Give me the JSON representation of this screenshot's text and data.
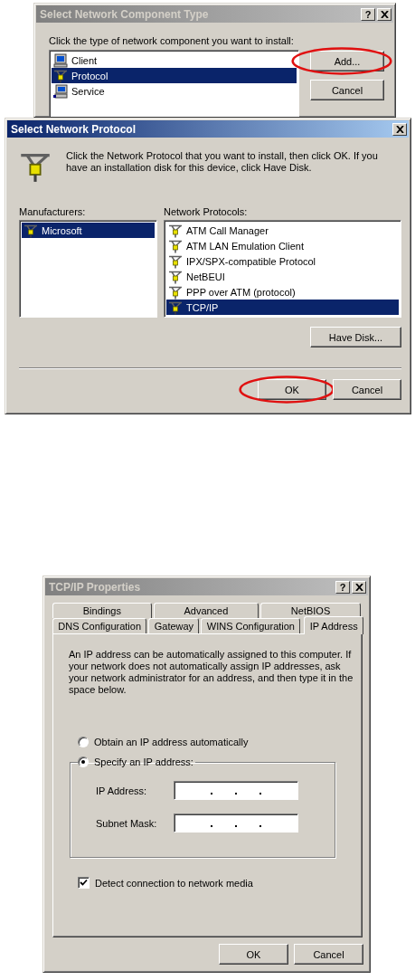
{
  "select_component_dialog": {
    "title": "Select Network Component Type",
    "active": false,
    "help_button": "?",
    "prompt": "Click the type of network component you want to install:",
    "items": [
      {
        "kind": "client",
        "label": "Client",
        "selected": false
      },
      {
        "kind": "protocol",
        "label": "Protocol",
        "selected": true
      },
      {
        "kind": "service",
        "label": "Service",
        "selected": false
      }
    ],
    "buttons": [
      {
        "label": "Add...",
        "highlighted": true
      },
      {
        "label": "Cancel",
        "highlighted": false
      }
    ]
  },
  "select_protocol_dialog": {
    "title": "Select Network Protocol",
    "active": true,
    "description": "Click the Network Protocol that you want to install, then click OK. If you have an installation disk for this device, click Have Disk.",
    "manufacturers_label": "Manufacturers:",
    "manufacturers": [
      {
        "label": "Microsoft",
        "selected": true
      }
    ],
    "protocols_label": "Network Protocols:",
    "protocols": [
      {
        "label": "ATM Call Manager",
        "selected": false
      },
      {
        "label": "ATM LAN Emulation Client",
        "selected": false
      },
      {
        "label": "IPX/SPX-compatible Protocol",
        "selected": false
      },
      {
        "label": "NetBEUI",
        "selected": false
      },
      {
        "label": "PPP over ATM (protocol)",
        "selected": false
      },
      {
        "label": "TCP/IP",
        "selected": true
      }
    ],
    "have_disk_button": "Have Disk...",
    "buttons": [
      {
        "label": "OK",
        "highlighted": true
      },
      {
        "label": "Cancel",
        "highlighted": false
      }
    ]
  },
  "tcpip_dialog": {
    "title": "TCP/IP Properties",
    "active": false,
    "help_button": "?",
    "tab_rows": [
      [
        {
          "label": "Bindings",
          "selected": false
        },
        {
          "label": "Advanced",
          "selected": false
        },
        {
          "label": "NetBIOS",
          "selected": false
        }
      ],
      [
        {
          "label": "DNS Configuration",
          "selected": false
        },
        {
          "label": "Gateway",
          "selected": false
        },
        {
          "label": "WINS Configuration",
          "selected": false
        },
        {
          "label": "IP Address",
          "selected": true
        }
      ]
    ],
    "description": "An IP address can be automatically assigned to this computer. If your network does not automatically assign IP addresses, ask your network administrator for an address, and then type it in the space below.",
    "obtain_radio": {
      "label": "Obtain an IP address automatically",
      "selected": false
    },
    "specify_radio": {
      "label": "Specify an IP address:",
      "selected": true
    },
    "fields": [
      {
        "label": "IP Address:"
      },
      {
        "label": "Subnet Mask:"
      }
    ],
    "checkbox": {
      "label": "Detect connection to network media",
      "checked": true
    },
    "buttons": [
      {
        "label": "OK"
      },
      {
        "label": "Cancel"
      }
    ]
  }
}
